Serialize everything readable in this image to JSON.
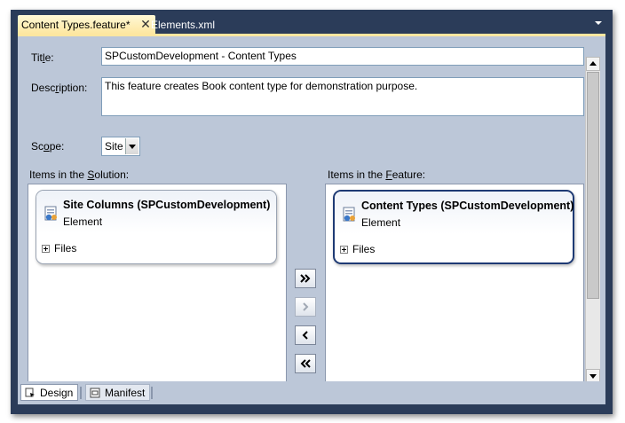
{
  "tabs": {
    "active_label": "Content Types.feature*",
    "close_glyph": "✕",
    "inactive_label": "Elements.xml"
  },
  "form": {
    "title_label_pre": "Tit",
    "title_label_u": "l",
    "title_label_post": "e:",
    "title_value": "SPCustomDevelopment - Content Types",
    "description_label_pre": "Desc",
    "description_label_u": "r",
    "description_label_post": "iption:",
    "description_value": "This feature creates Book content type for demonstration purpose.",
    "scope_label_pre": "Sc",
    "scope_label_u": "o",
    "scope_label_post": "pe:",
    "scope_value": "Site"
  },
  "solution_panel": {
    "label_pre": "Items in the ",
    "label_u": "S",
    "label_post": "olution:",
    "items": [
      {
        "title": "Site Columns (SPCustomDevelopment)",
        "subtitle": "Element",
        "files_label": "Files"
      }
    ]
  },
  "feature_panel": {
    "label_pre": "Items in the ",
    "label_u": "F",
    "label_post": "eature:",
    "items": [
      {
        "title": "Content Types (SPCustomDevelopment)",
        "subtitle": "Element",
        "files_label": "Files"
      }
    ]
  },
  "icons": {
    "move_all_right": "double-chevron-right-icon",
    "move_right": "chevron-right-icon",
    "move_left": "chevron-left-icon",
    "move_all_left": "double-chevron-left-icon",
    "element": "feature-element-icon"
  },
  "bottom_tabs": {
    "design_label": "Design",
    "manifest_label": "Manifest"
  },
  "colors": {
    "frame": "#2b3c59",
    "editor_bg": "#bcc7d8",
    "active_tab": "#fde7a0",
    "selected_border": "#1e3a74"
  }
}
